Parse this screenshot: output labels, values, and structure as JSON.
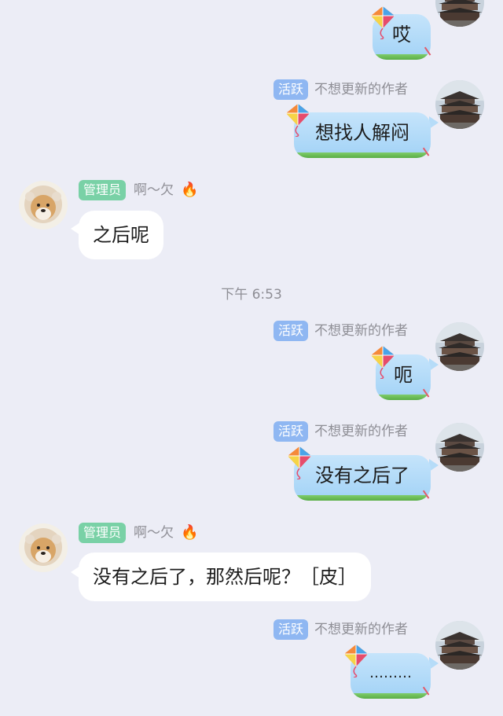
{
  "messages": [
    {
      "text": "哎"
    },
    {
      "badge": "活跃",
      "sender": "不想更新的作者",
      "text": "想找人解闷"
    },
    {
      "badge": "管理员",
      "sender": "啊～欠",
      "text": "之后呢"
    },
    {
      "badge": "活跃",
      "sender": "不想更新的作者",
      "text": "呃"
    },
    {
      "badge": "活跃",
      "sender": "不想更新的作者",
      "text": "没有之后了"
    },
    {
      "badge": "管理员",
      "sender": "啊～欠",
      "text": "没有之后了，那然后呢？［皮］"
    },
    {
      "badge": "活跃",
      "sender": "不想更新的作者",
      "text": "………"
    }
  ],
  "timestamp": "下午 6:53",
  "icons": {
    "kite": "kite-sticker-icon",
    "fire": "fire-icon"
  },
  "colors": {
    "background": "#ecedf6",
    "active_badge": "#8fb7f2",
    "admin_badge": "#79d1a6",
    "out_bubble": "#b6dcf8",
    "in_bubble": "#ffffff"
  }
}
